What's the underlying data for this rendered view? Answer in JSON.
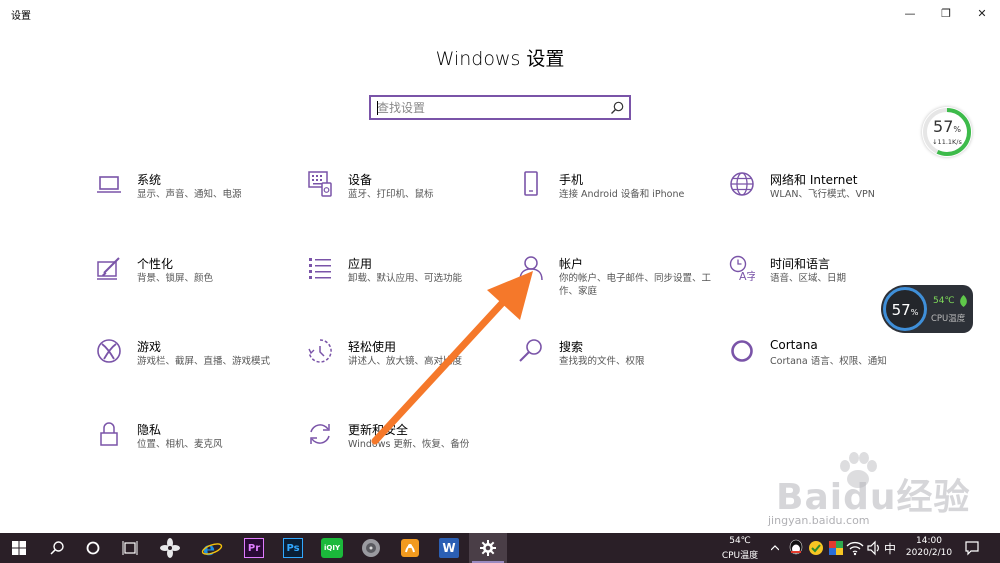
{
  "window": {
    "app_title": "设置",
    "minimize_glyph": "—",
    "maximize_glyph": "❐",
    "close_glyph": "✕"
  },
  "main_title": "Windows 设置",
  "search": {
    "placeholder": "查找设置"
  },
  "tiles": [
    {
      "title": "系统",
      "desc": "显示、声音、通知、电源",
      "icon": "laptop-icon"
    },
    {
      "title": "设备",
      "desc": "蓝牙、打印机、鼠标",
      "icon": "keyboard-icon"
    },
    {
      "title": "手机",
      "desc": "连接 Android 设备和 iPhone",
      "icon": "phone-icon"
    },
    {
      "title": "网络和 Internet",
      "desc": "WLAN、飞行模式、VPN",
      "icon": "globe-icon"
    },
    {
      "title": "个性化",
      "desc": "背景、锁屏、颜色",
      "icon": "paint-icon"
    },
    {
      "title": "应用",
      "desc": "卸载、默认应用、可选功能",
      "icon": "apps-list-icon"
    },
    {
      "title": "帐户",
      "desc": "你的帐户、电子邮件、同步设置、工作、家庭",
      "icon": "person-icon"
    },
    {
      "title": "时间和语言",
      "desc": "语音、区域、日期",
      "icon": "clock-language-icon"
    },
    {
      "title": "游戏",
      "desc": "游戏栏、截屏、直播、游戏模式",
      "icon": "xbox-icon"
    },
    {
      "title": "轻松使用",
      "desc": "讲述人、放大镜、高对比度",
      "icon": "ease-of-access-icon"
    },
    {
      "title": "搜索",
      "desc": "查找我的文件、权限",
      "icon": "search-icon"
    },
    {
      "title": "Cortana",
      "desc": "Cortana 语言、权限、通知",
      "icon": "cortana-icon"
    },
    {
      "title": "隐私",
      "desc": "位置、相机、麦克风",
      "icon": "lock-icon"
    },
    {
      "title": "更新和安全",
      "desc": "Windows 更新、恢复、备份",
      "icon": "sync-icon"
    }
  ],
  "net_gauge": {
    "percent": "57",
    "unit": "%",
    "speed": "↓11.1K/s",
    "level": 0.57
  },
  "cpu_widget": {
    "percent": "57",
    "unit": "%",
    "temp": "54℃",
    "label": "CPU温度"
  },
  "taskbar": {
    "pinned": [
      "windows-start-icon",
      "search-icon",
      "cortana-circle-icon",
      "task-view-icon",
      "pinwheel-app-icon",
      "ie-icon",
      "premiere-icon",
      "photoshop-icon",
      "iqiyi-icon",
      "media-player-icon",
      "app-orange-icon",
      "word-icon",
      "settings-gear-icon"
    ],
    "premiere_label": "Pr",
    "photoshop_label": "Ps",
    "iqiyi_label": "iQIY",
    "word_label": "W",
    "cpu_temp": "54℃",
    "cpu_temp_label": "CPU温度",
    "ime": "中",
    "time": "14:00",
    "date": "2020/2/10"
  },
  "watermark": {
    "brand": "Baidu经验",
    "url": "jingyan.baidu.com"
  },
  "colors": {
    "accent": "#7a54a8",
    "arrow": "#f5782a",
    "taskbar": "#2a1f27",
    "gauge_green": "#3dbb4a"
  }
}
